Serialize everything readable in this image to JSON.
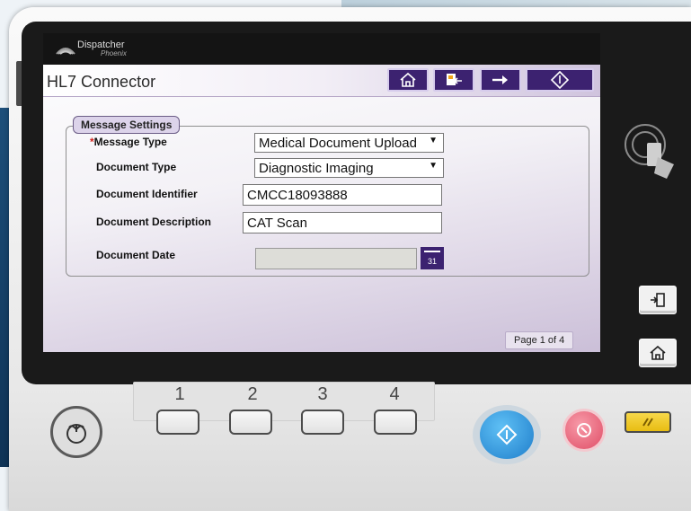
{
  "app": {
    "brand": "Dispatcher",
    "brand_sub": "Phoenix"
  },
  "screen": {
    "title": "HL7 Connector",
    "nav_buttons": [
      "home-icon",
      "back-doc-icon",
      "next-arrow-icon",
      "start-icon"
    ],
    "section_title": "Message Settings",
    "fields": [
      {
        "label": "Message Type",
        "required": true,
        "value": "Medical Document Upload",
        "type": "select"
      },
      {
        "label": "Document Type",
        "required": false,
        "value": "Diagnostic Imaging",
        "type": "select"
      },
      {
        "label": "Document Identifier",
        "required": false,
        "value": "CMCC18093888",
        "type": "text"
      },
      {
        "label": "Document Description",
        "required": false,
        "value": "CAT Scan",
        "type": "text"
      },
      {
        "label": "Document Date",
        "required": false,
        "value": "",
        "type": "date"
      }
    ],
    "required_marker": "*",
    "calendar_day": "31",
    "page_indicator": "Page 1 of 4"
  },
  "keypad": {
    "keys": [
      "1",
      "2",
      "3",
      "4"
    ]
  },
  "colors": {
    "accent": "#3c2270",
    "start": "#2f8ed6",
    "stop": "#e8627a",
    "reset": "#f2cf26"
  }
}
